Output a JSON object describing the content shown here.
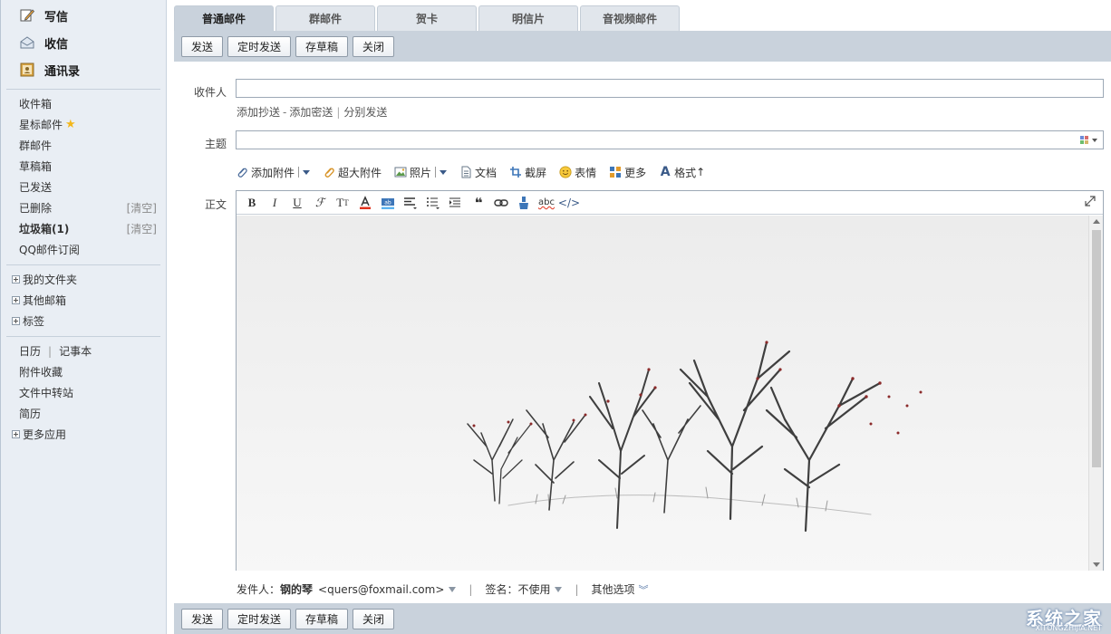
{
  "sidebar": {
    "top_actions": [
      {
        "label": "写信",
        "icon": "pen-icon"
      },
      {
        "label": "收信",
        "icon": "inbox-icon"
      },
      {
        "label": "通讯录",
        "icon": "contacts-icon"
      }
    ],
    "mail_folders": [
      {
        "label": "收件箱"
      },
      {
        "label": "星标邮件"
      },
      {
        "label": "群邮件"
      },
      {
        "label": "草稿箱"
      },
      {
        "label": "已发送"
      },
      {
        "label": "已删除",
        "action": "[清空]"
      },
      {
        "label": "垃圾箱(1)",
        "action": "[清空]"
      },
      {
        "label": "QQ邮件订阅"
      }
    ],
    "expandable": [
      {
        "label": "我的文件夹"
      },
      {
        "label": "其他邮箱"
      },
      {
        "label": "标签"
      }
    ],
    "tools": {
      "calendar": "日历",
      "notes": "记事本",
      "attachments": "附件收藏",
      "transfer": "文件中转站",
      "resume": "简历",
      "more_apps": "更多应用"
    }
  },
  "tabs": [
    "普通邮件",
    "群邮件",
    "贺卡",
    "明信片",
    "音视频邮件"
  ],
  "toolbar": {
    "send": "发送",
    "scheduled_send": "定时发送",
    "save_draft": "存草稿",
    "close": "关闭"
  },
  "compose": {
    "recipient_label": "收件人",
    "recipient_value": "",
    "add_cc": "添加抄送",
    "add_bcc": "添加密送",
    "separate_send": "分别发送",
    "subject_label": "主题",
    "subject_value": "",
    "body_label": "正文",
    "attach_tools": {
      "add_attachment": "添加附件",
      "large_attachment": "超大附件",
      "photo": "照片",
      "document": "文档",
      "screenshot": "截屏",
      "emoji": "表情",
      "more": "更多",
      "format": "格式"
    },
    "sender_label": "发件人：",
    "sender_name": "钢的琴",
    "sender_email": "<quers@foxmail.com>",
    "signature": "签名：不使用",
    "other_options": "其他选项"
  },
  "colors": {
    "toolbar_bg": "#c9d2dc",
    "sidebar_bg": "#e9eef4",
    "star": "#f3b71b"
  },
  "watermark": {
    "text": "系统之家",
    "sub": "XITONGZHIJIA.NET"
  }
}
